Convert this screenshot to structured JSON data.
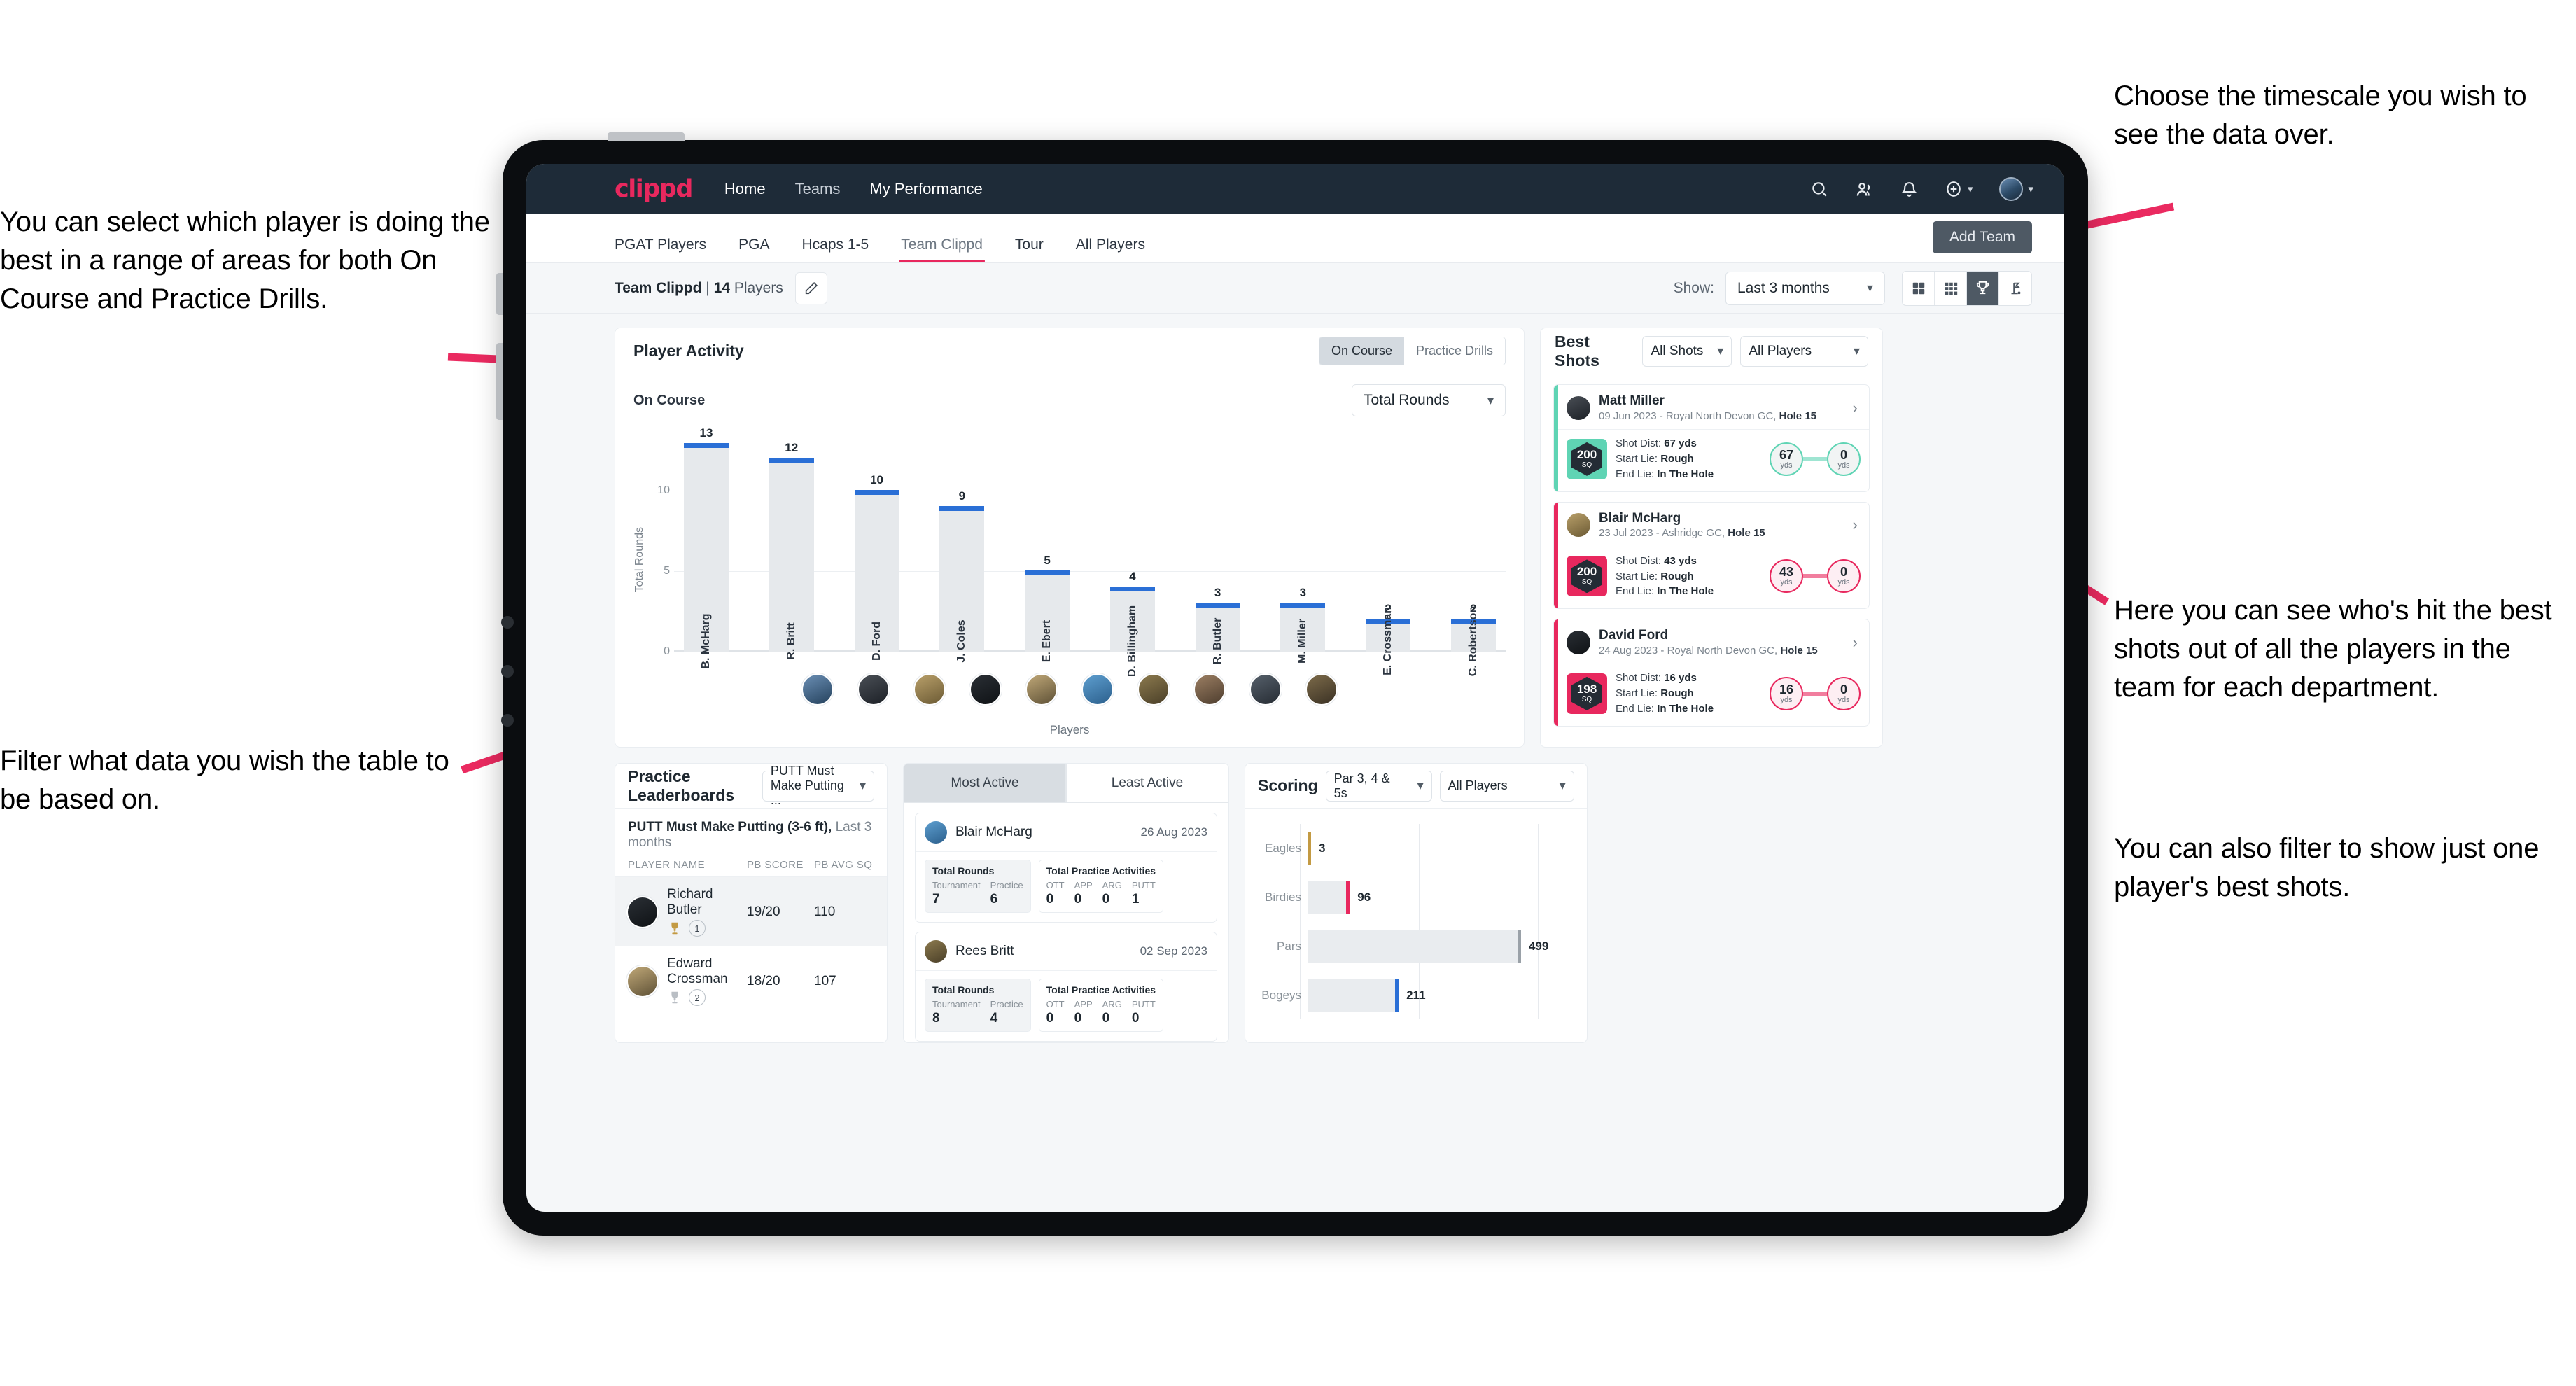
{
  "annotations": {
    "left_top": "You can select which player is doing the best in a range of areas for both On Course and Practice Drills.",
    "left_bottom": "Filter what data you wish the table to be based on.",
    "right_top": "Choose the timescale you wish to see the data over.",
    "right_mid": "Here you can see who's hit the best shots out of all the players in the team for each department.",
    "right_bottom": "You can also filter to show just one player's best shots."
  },
  "topbar": {
    "logo": "clippd",
    "links": [
      {
        "label": "Home",
        "active": true
      },
      {
        "label": "Teams",
        "active": false
      },
      {
        "label": "My Performance",
        "active": true
      }
    ],
    "icons": [
      "search-icon",
      "people-icon",
      "bell-icon",
      "plus-circle-icon",
      "avatar"
    ]
  },
  "subtabs": {
    "items": [
      {
        "label": "PGAT Players",
        "active": false
      },
      {
        "label": "PGA",
        "active": false
      },
      {
        "label": "Hcaps 1-5",
        "active": false
      },
      {
        "label": "Team Clippd",
        "active": true
      },
      {
        "label": "Tour",
        "active": false
      },
      {
        "label": "All Players",
        "active": false
      }
    ],
    "add_team": "Add Team"
  },
  "filterbar": {
    "team_name": "Team Clippd",
    "separator": "|",
    "player_count": "14",
    "players_word": "Players",
    "show_label": "Show:",
    "timescale": "Last 3 months",
    "views": [
      {
        "icon": "grid-4-icon",
        "active": false
      },
      {
        "icon": "grid-9-icon",
        "active": false
      },
      {
        "icon": "trophy-icon",
        "active": true
      },
      {
        "icon": "golf-flag-icon",
        "active": false
      }
    ]
  },
  "player_activity": {
    "title": "Player Activity",
    "segments": [
      {
        "label": "On Course",
        "active": true
      },
      {
        "label": "Practice Drills",
        "active": false
      }
    ],
    "sub_label": "On Course",
    "metric": "Total Rounds",
    "xlabel": "Players"
  },
  "chart_data": {
    "type": "bar",
    "title": "Player Activity — On Course",
    "categories": [
      "B. McHarg",
      "R. Britt",
      "D. Ford",
      "J. Coles",
      "E. Ebert",
      "D. Billingham",
      "R. Butler",
      "M. Miller",
      "E. Crossman",
      "C. Robertson"
    ],
    "values": [
      13,
      12,
      10,
      9,
      5,
      4,
      3,
      3,
      2,
      2
    ],
    "xlabel": "Players",
    "ylabel": "Total Rounds",
    "yticks": [
      0,
      5,
      10
    ],
    "ylim": [
      0,
      14
    ],
    "grid": true,
    "legend": "none",
    "bar_color": "#e6e9ec",
    "cap_color": "#2a6fd6"
  },
  "best_shots": {
    "title": "Best Shots",
    "shot_filter": "All Shots",
    "player_filter": "All Players",
    "items": [
      {
        "name": "Matt Miller",
        "meta_prefix": "09 Jun 2023 - Royal North Devon GC,",
        "hole": "Hole 15",
        "sq": "200",
        "sq_unit": "SQ",
        "shot_dist_label": "Shot Dist:",
        "shot_dist": "67 yds",
        "start_lie_label": "Start Lie:",
        "start_lie": "Rough",
        "end_lie_label": "End Lie:",
        "end_lie": "In The Hole",
        "from_val": "67",
        "from_unit": "yds",
        "to_val": "0",
        "to_unit": "yds",
        "accent": "#5fd4b4",
        "box_bg": "#5fd4b4",
        "circle_bg": "#f1f4f4"
      },
      {
        "name": "Blair McHarg",
        "meta_prefix": "23 Jul 2023 - Ashridge GC,",
        "hole": "Hole 15",
        "sq": "200",
        "sq_unit": "SQ",
        "shot_dist_label": "Shot Dist:",
        "shot_dist": "43 yds",
        "start_lie_label": "Start Lie:",
        "start_lie": "Rough",
        "end_lie_label": "End Lie:",
        "end_lie": "In The Hole",
        "from_val": "43",
        "from_unit": "yds",
        "to_val": "0",
        "to_unit": "yds",
        "accent": "#e8285e",
        "box_bg": "#e8285e",
        "circle_bg": "#fdeef3"
      },
      {
        "name": "David Ford",
        "meta_prefix": "24 Aug 2023 - Royal North Devon GC,",
        "hole": "Hole 15",
        "sq": "198",
        "sq_unit": "SQ",
        "shot_dist_label": "Shot Dist:",
        "shot_dist": "16 yds",
        "start_lie_label": "Start Lie:",
        "start_lie": "Rough",
        "end_lie_label": "End Lie:",
        "end_lie": "In The Hole",
        "from_val": "16",
        "from_unit": "yds",
        "to_val": "0",
        "to_unit": "yds",
        "accent": "#e8285e",
        "box_bg": "#e8285e",
        "circle_bg": "#fdeef3"
      }
    ]
  },
  "practice_leaderboards": {
    "title": "Practice Leaderboards",
    "drill_select": "PUTT Must Make Putting ...",
    "sub_bold": "PUTT Must Make Putting (3-6 ft),",
    "sub_light": "Last 3 months",
    "columns": [
      "PLAYER NAME",
      "PB SCORE",
      "PB AVG SQ"
    ],
    "rows": [
      {
        "name": "Richard Butler",
        "score": "19/20",
        "avg_sq": "110",
        "rank": "1",
        "trophy": "gold",
        "highlight": true
      },
      {
        "name": "Edward Crossman",
        "score": "18/20",
        "avg_sq": "107",
        "rank": "2",
        "trophy": "silver",
        "highlight": false
      }
    ]
  },
  "activity": {
    "tabs": [
      {
        "label": "Most Active",
        "active": true
      },
      {
        "label": "Least Active",
        "active": false
      }
    ],
    "rounds_title": "Total Rounds",
    "practice_title": "Total Practice Activities",
    "rounds_keys": [
      "Tournament",
      "Practice"
    ],
    "practice_keys": [
      "OTT",
      "APP",
      "ARG",
      "PUTT"
    ],
    "cards": [
      {
        "name": "Blair McHarg",
        "date": "26 Aug 2023",
        "rounds": [
          "7",
          "6"
        ],
        "practice": [
          "0",
          "0",
          "0",
          "1"
        ]
      },
      {
        "name": "Rees Britt",
        "date": "02 Sep 2023",
        "rounds": [
          "8",
          "4"
        ],
        "practice": [
          "0",
          "0",
          "0",
          "0"
        ]
      }
    ]
  },
  "scoring": {
    "title": "Scoring",
    "par_filter": "Par 3, 4 & 5s",
    "player_filter": "All Players",
    "chart": {
      "type": "bar",
      "orientation": "horizontal",
      "categories": [
        "Eagles",
        "Birdies",
        "Pars",
        "Bogeys"
      ],
      "values": [
        3,
        96,
        499,
        211
      ],
      "colors": [
        "#c39a43",
        "#e8285e",
        "#9aa1a8",
        "#2a6fd6"
      ],
      "xmax": 560,
      "grid": true
    }
  }
}
